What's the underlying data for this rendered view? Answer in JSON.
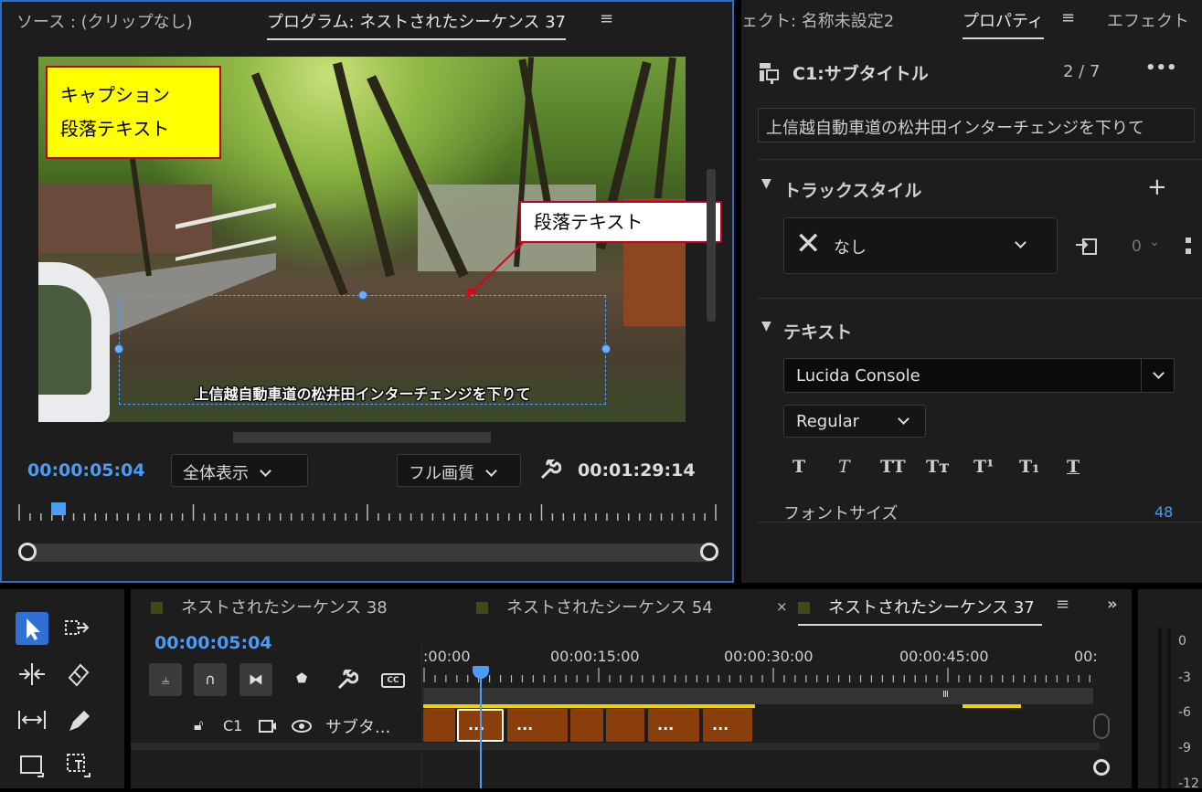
{
  "program_panel": {
    "tab_source": "ソース : (クリップなし)",
    "tab_program": "プログラム: ネストされたシーケンス 37",
    "menu_icon": "≡",
    "caption_text": "上信越自動車道の松井田インターチェンジを下りて",
    "callout_yellow_line1": "キャプション",
    "callout_yellow_line2": "段落テキスト",
    "callout_white": "段落テキスト",
    "current_timecode": "00:00:05:04",
    "zoom_select": "全体表示",
    "quality_select": "フル画質",
    "duration_timecode": "00:01:29:14",
    "playhead_position_fraction": 0.058
  },
  "props_panel": {
    "tab_effect_controls": "ェクト: 名称未設定2",
    "tab_properties": "プロパティ",
    "tab_effects": "エフェクト",
    "menu_icon": "≡",
    "caption_title": "C1:サブタイトル",
    "caption_counter": "2 / 7",
    "more_label": "•••",
    "caption_text_field": "上信越自動車道の松井田インターチェンジを下りて",
    "track_style_header": "トラックスタイル",
    "track_style_value": "なし",
    "track_style_count": "0",
    "text_header": "テキスト",
    "font_family": "Lucida Console",
    "font_style": "Regular",
    "format_buttons": [
      "T",
      "T",
      "TT",
      "Tт",
      "T¹",
      "T₁",
      "T"
    ],
    "font_size_label": "フォントサイズ",
    "font_size_value": "48"
  },
  "timeline_panel": {
    "tab_1": "ネストされたシーケンス 38",
    "tab_2": "ネストされたシーケンス 54",
    "tab_3": "ネストされたシーケンス 37",
    "close_icon": "×",
    "menu_icon": "≡",
    "overflow_icon": "»",
    "current_timecode": "00:00:05:04",
    "ruler_labels": [
      ":00:00",
      "00:00:15:00",
      "00:00:30:00",
      "00:00:45:00",
      "00:"
    ],
    "track_name_short": "C1",
    "track_label": "サブタ...",
    "clip_ellipsis": "..."
  },
  "meter": {
    "labels": [
      "0",
      "-3",
      "-6",
      "-9",
      "-12"
    ]
  },
  "colors": {
    "accent_blue": "#4a9cf5",
    "clip_orange": "#8a3e0b",
    "callout_yellow": "#ffff00",
    "callout_border": "#c0001e",
    "in_out_yellow": "#f0d000"
  }
}
